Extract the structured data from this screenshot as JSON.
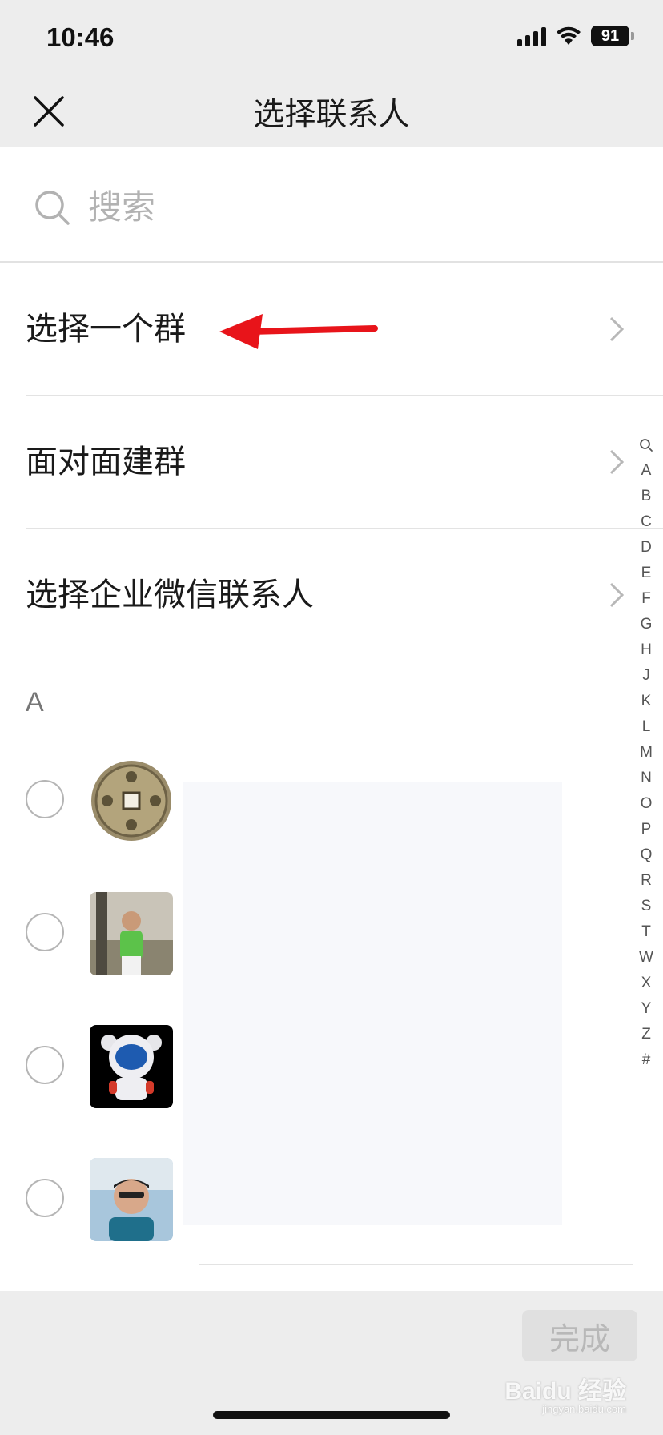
{
  "status_bar": {
    "time": "10:46",
    "battery": "91"
  },
  "nav": {
    "title": "选择联系人"
  },
  "search": {
    "placeholder": "搜索"
  },
  "menu": [
    {
      "label": "选择一个群"
    },
    {
      "label": "面对面建群"
    },
    {
      "label": "选择企业微信联系人"
    }
  ],
  "section": {
    "letter": "A"
  },
  "index_letters": [
    "A",
    "B",
    "C",
    "D",
    "E",
    "F",
    "G",
    "H",
    "J",
    "K",
    "L",
    "M",
    "N",
    "O",
    "P",
    "Q",
    "R",
    "S",
    "T",
    "W",
    "X",
    "Y",
    "Z",
    "#"
  ],
  "footer": {
    "done_label": "完成",
    "watermark": "Baidu 经验",
    "watermark_sub": "jingyan.baidu.com"
  },
  "colors": {
    "accent_arrow": "#e8141a",
    "background": "#ededed"
  },
  "icons": {
    "close": "close-icon",
    "search": "search-icon",
    "chevron": "chevron-right-icon"
  }
}
